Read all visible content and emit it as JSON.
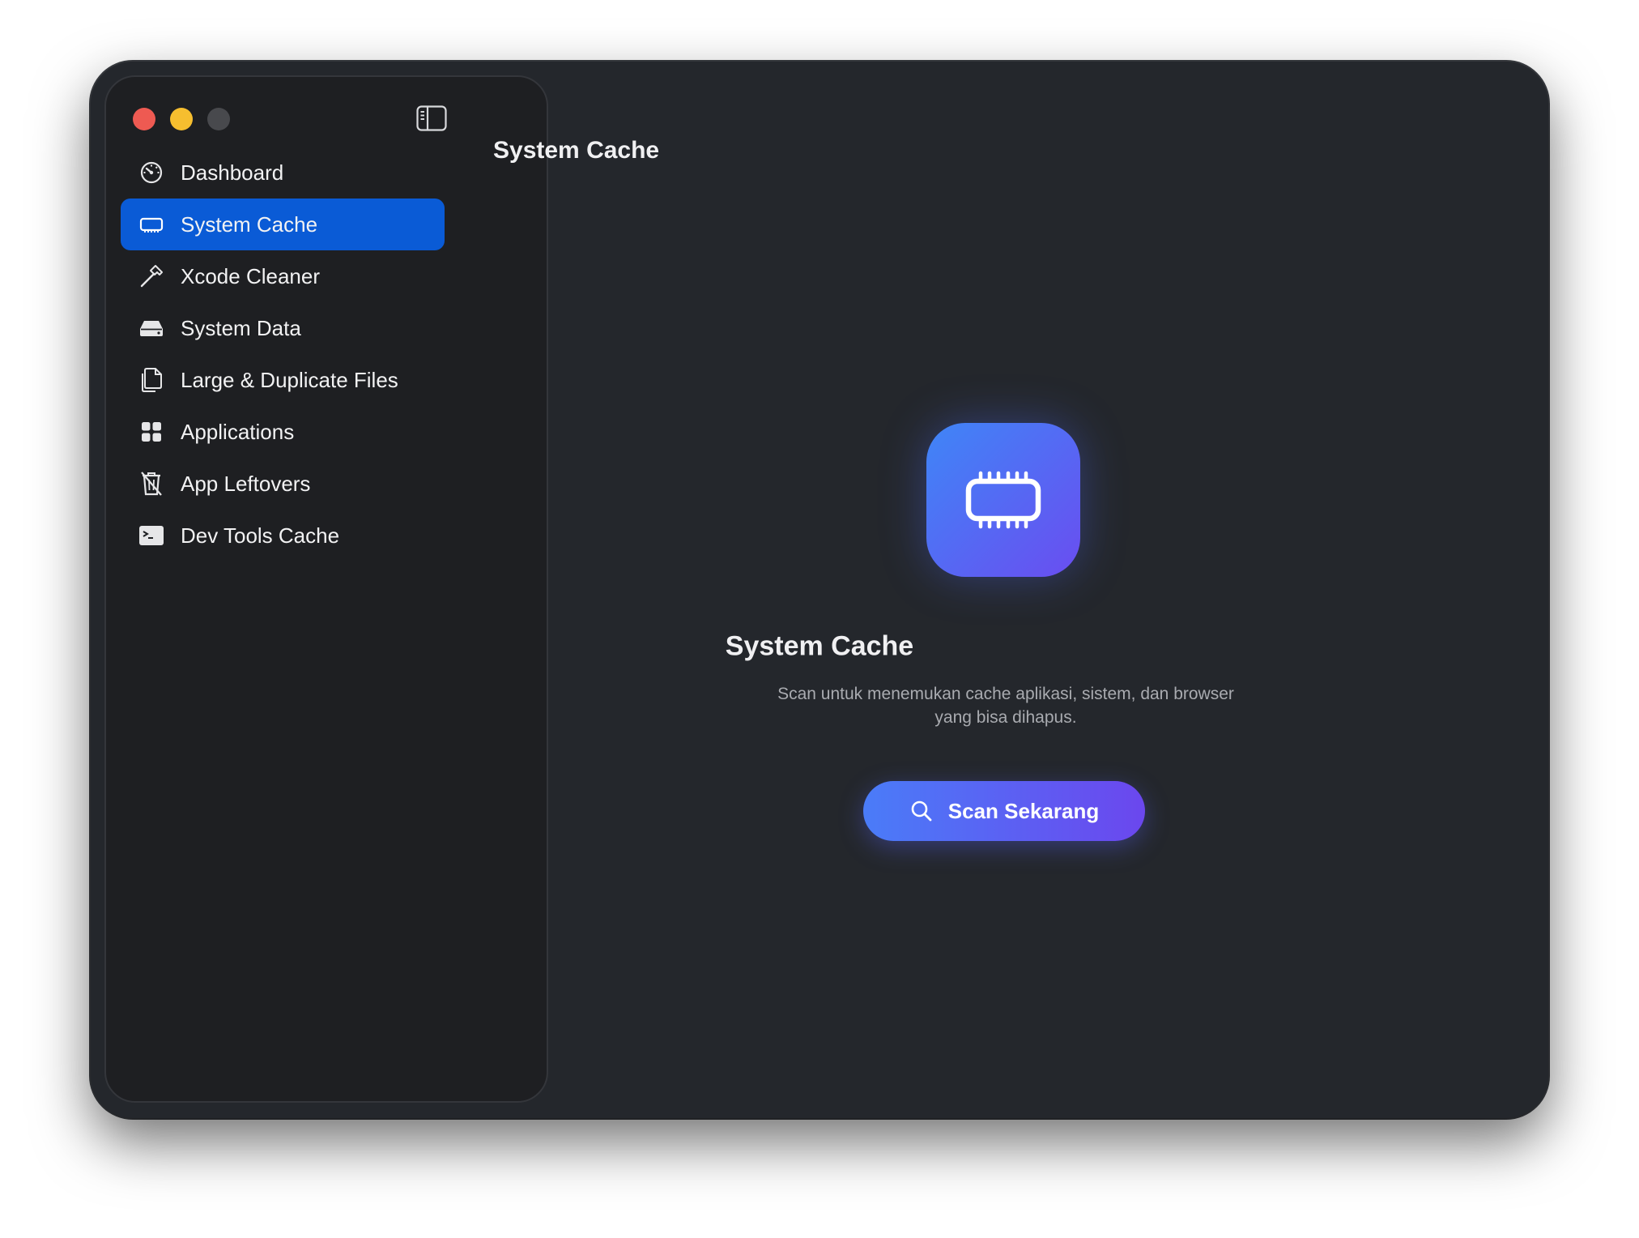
{
  "window": {
    "controls": [
      "close",
      "minimize",
      "maximize"
    ]
  },
  "sidebar": {
    "items": [
      {
        "label": "Dashboard",
        "icon": "gauge-icon",
        "active": false
      },
      {
        "label": "System Cache",
        "icon": "memory-chip-icon",
        "active": true
      },
      {
        "label": "Xcode Cleaner",
        "icon": "hammer-icon",
        "active": false
      },
      {
        "label": "System Data",
        "icon": "drive-icon",
        "active": false
      },
      {
        "label": "Large & Duplicate Files",
        "icon": "duplicate-docs-icon",
        "active": false
      },
      {
        "label": "Applications",
        "icon": "grid-icon",
        "active": false
      },
      {
        "label": "App Leftovers",
        "icon": "trash-slash-icon",
        "active": false
      },
      {
        "label": "Dev Tools Cache",
        "icon": "terminal-icon",
        "active": false
      }
    ]
  },
  "header": {
    "title": "System Cache"
  },
  "main": {
    "hero_icon": "memory-chip-icon",
    "title": "System Cache",
    "description_line1": "Scan untuk menemukan cache aplikasi, sistem, dan browser",
    "description_line2": "yang bisa dihapus.",
    "scan_button_label": "Scan Sekarang"
  },
  "colors": {
    "window_bg": "#24272c",
    "sidebar_bg": "#1e1f22",
    "active_item": "#0a5bd6",
    "accent_start": "#3f86f7",
    "accent_end": "#6a4df0",
    "close": "#ee5a52",
    "minimize": "#f6be2f",
    "maximize_inactive": "#48494d"
  }
}
